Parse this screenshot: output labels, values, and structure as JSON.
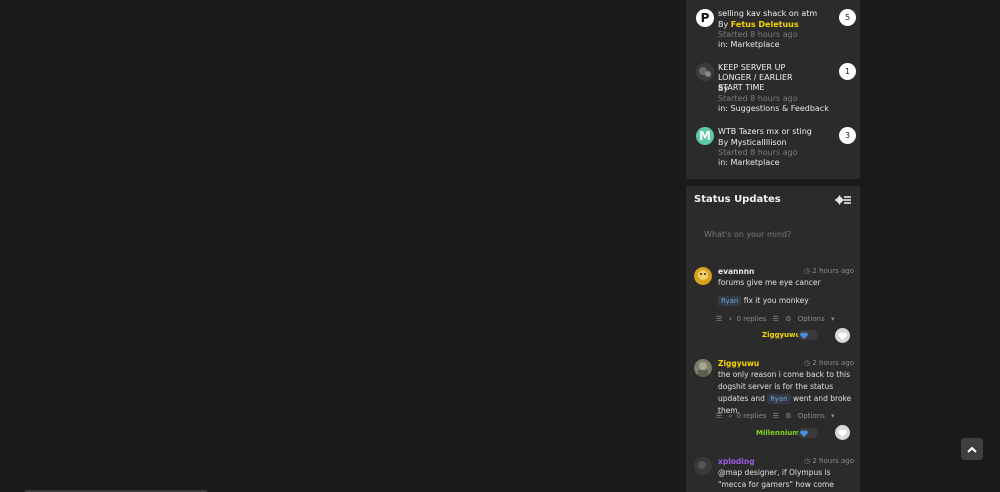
{
  "topics": [
    {
      "title": "selling kav shack on atm",
      "by_prefix": "By ",
      "author": "Fetus Deletuus",
      "author_color": "#f5d800",
      "started": "Started 8 hours ago",
      "in_label": "in: Marketplace",
      "replies": "5",
      "avatar_letter": "P"
    },
    {
      "title": "KEEP SERVER UP LONGER / EARLIER START TIME",
      "by_prefix": "By ",
      "author": "",
      "author_color": "#2f7d2f",
      "started": "Started 8 hours ago",
      "in_label": "in: Suggestions & Feedback",
      "replies": "1",
      "avatar_letter": ""
    },
    {
      "title": "WTB Tazers mx or sting",
      "by_prefix": "By ",
      "author": "MysticalIllison",
      "author_color": "#f0f0f0",
      "started": "Started 8 hours ago",
      "in_label": "in: Marketplace",
      "replies": "3",
      "avatar_letter": "M"
    }
  ],
  "status_updates": {
    "title": "Status Updates",
    "placeholder": "What's on your mind?",
    "items": [
      {
        "author": "evannnn",
        "author_color": "#e8e8e8",
        "time": "2 hours ago",
        "text": "forums give me eye cancer",
        "reply_mention": "Ryan",
        "reply_text": " fix it you monkey",
        "replies": "0 replies",
        "options": "Options",
        "liker": "Ziggyuwu",
        "liker_color": "#f5d800"
      },
      {
        "author": "Ziggyuwu",
        "author_color": "#f5d800",
        "time": "2 hours ago",
        "text": "the only reason i come back to this dogshit server is for the status updates and ",
        "mention": "Ryan",
        "text_after": " went and broke them.",
        "replies": "0 replies",
        "options": "Options",
        "liker": "Millennium",
        "liker_color": "#7ed321"
      },
      {
        "author": "xploding",
        "author_color": "#9b5de5",
        "time": "2 hours ago",
        "text": "@map designer, if Olympus is \"mecca for gamers\" how come there's no mosque?"
      }
    ]
  }
}
